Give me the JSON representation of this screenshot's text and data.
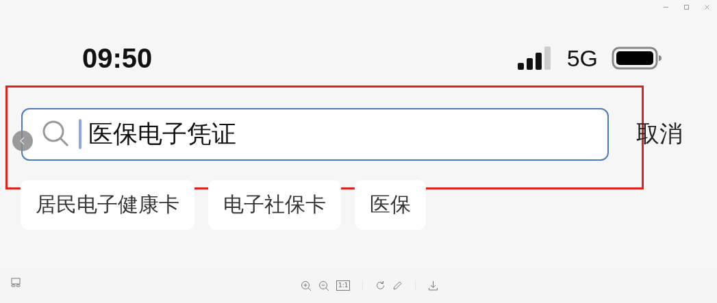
{
  "status_bar": {
    "time": "09:50",
    "network": "5G"
  },
  "search": {
    "value": "医保电子凭证",
    "cancel": "取消",
    "highlighted": true
  },
  "suggestions": [
    "居民电子健康卡",
    "电子社保卡",
    "医保"
  ],
  "viewer_toolbar": {
    "actual_size": "1:1"
  }
}
